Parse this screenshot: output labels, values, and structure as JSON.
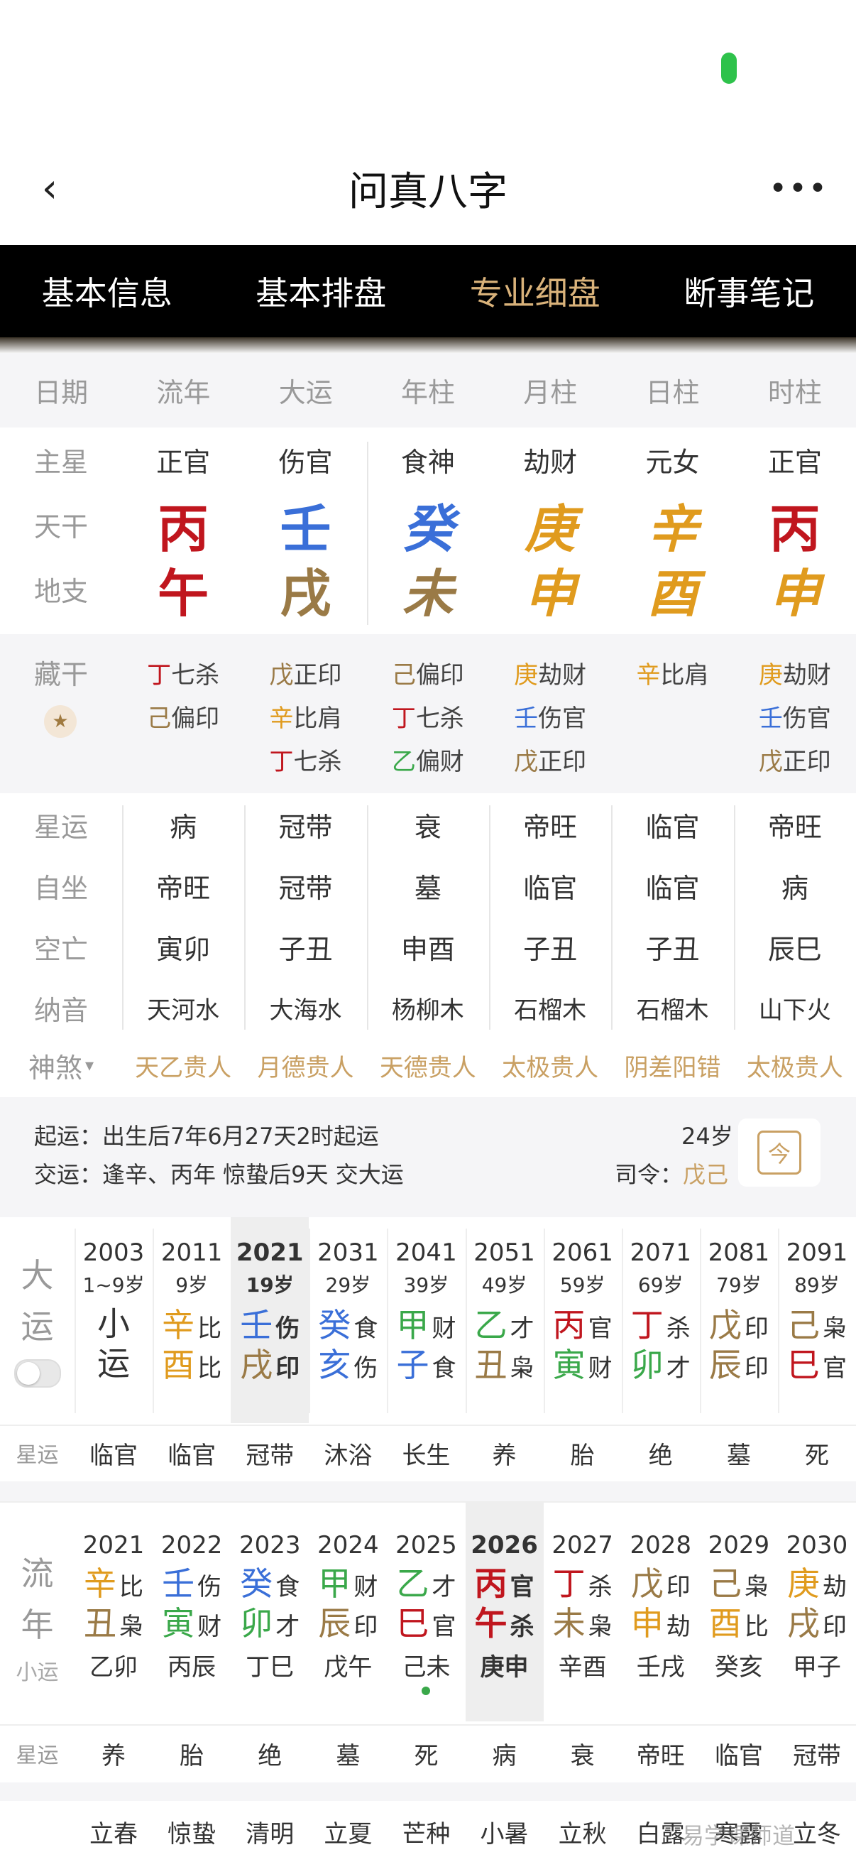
{
  "app": {
    "title": "问真八字",
    "back": "‹",
    "more": "•••"
  },
  "tabs": [
    {
      "label": "基本信息"
    },
    {
      "label": "基本排盘"
    },
    {
      "label": "专业细盘"
    },
    {
      "label": "断事笔记"
    }
  ],
  "pillar_header": [
    "日期",
    "流年",
    "大运",
    "年柱",
    "月柱",
    "日柱",
    "时柱"
  ],
  "main_star": {
    "label": "主星",
    "values": [
      "正官",
      "伤官",
      "食神",
      "劫财",
      "元女",
      "正官"
    ]
  },
  "tiangan": {
    "label": "天干",
    "values": [
      "丙",
      "壬",
      "癸",
      "庚",
      "辛",
      "丙"
    ],
    "colors": [
      "#c0161e",
      "#3a6fd8",
      "#3a6fd8",
      "#e09b1e",
      "#e09b1e",
      "#c0161e"
    ]
  },
  "dizhi": {
    "label": "地支",
    "values": [
      "午",
      "戌",
      "未",
      "申",
      "酉",
      "申"
    ],
    "colors": [
      "#c0161e",
      "#9a7a46",
      "#9a7a46",
      "#e09b1e",
      "#e09b1e",
      "#e09b1e"
    ]
  },
  "canggan": {
    "label": "藏干",
    "cols": [
      [
        {
          "g": "丁",
          "s": "七杀",
          "c": "#c0161e"
        },
        {
          "g": "己",
          "s": "偏印",
          "c": "#9a7a46"
        }
      ],
      [
        {
          "g": "戊",
          "s": "正印",
          "c": "#9a7a46"
        },
        {
          "g": "辛",
          "s": "比肩",
          "c": "#e09b1e"
        },
        {
          "g": "丁",
          "s": "七杀",
          "c": "#c0161e"
        }
      ],
      [
        {
          "g": "己",
          "s": "偏印",
          "c": "#9a7a46"
        },
        {
          "g": "丁",
          "s": "七杀",
          "c": "#c0161e"
        },
        {
          "g": "乙",
          "s": "偏财",
          "c": "#3aa84a"
        }
      ],
      [
        {
          "g": "庚",
          "s": "劫财",
          "c": "#e09b1e"
        },
        {
          "g": "壬",
          "s": "伤官",
          "c": "#3a6fd8"
        },
        {
          "g": "戊",
          "s": "正印",
          "c": "#9a7a46"
        }
      ],
      [
        {
          "g": "辛",
          "s": "比肩",
          "c": "#e09b1e"
        }
      ],
      [
        {
          "g": "庚",
          "s": "劫财",
          "c": "#e09b1e"
        },
        {
          "g": "壬",
          "s": "伤官",
          "c": "#3a6fd8"
        },
        {
          "g": "戊",
          "s": "正印",
          "c": "#9a7a46"
        }
      ]
    ]
  },
  "xingyun": {
    "label": "星运",
    "values": [
      "病",
      "冠带",
      "衰",
      "帝旺",
      "临官",
      "帝旺"
    ]
  },
  "zizuo": {
    "label": "自坐",
    "values": [
      "帝旺",
      "冠带",
      "墓",
      "临官",
      "临官",
      "病"
    ]
  },
  "kongwang": {
    "label": "空亡",
    "values": [
      "寅卯",
      "子丑",
      "申酉",
      "子丑",
      "子丑",
      "辰巳"
    ]
  },
  "nayin": {
    "label": "纳音",
    "values": [
      "天河水",
      "大海水",
      "杨柳木",
      "石榴木",
      "石榴木",
      "山下火"
    ]
  },
  "shensha": {
    "label": "神煞",
    "arrow": "▾",
    "values": [
      "天乙贵人",
      "月德贵人",
      "天德贵人",
      "太极贵人",
      "阴差阳错",
      "太极贵人"
    ]
  },
  "info": {
    "qiyun": "起运：出生后7年6月27天2时起运",
    "jiaoyun": "交运：逢辛、丙年 惊蛰后9天 交大运",
    "age": "24岁",
    "siling_label": "司令：",
    "siling_value": "戊己",
    "calendar_glyph": "今"
  },
  "dayun": {
    "label_chars": [
      "大",
      "运"
    ],
    "xiaoyun": {
      "year": "2003",
      "age": "1~9岁",
      "c1": "小",
      "c2": "运"
    },
    "cols": [
      {
        "year": "2011",
        "age": "9岁",
        "g1": "辛",
        "s1": "比",
        "c1": "#e09b1e",
        "g2": "酉",
        "s2": "比",
        "c2": "#e09b1e"
      },
      {
        "year": "2021",
        "age": "19岁",
        "g1": "壬",
        "s1": "伤",
        "c1": "#3a6fd8",
        "g2": "戌",
        "s2": "印",
        "c2": "#9a7a46",
        "active": true
      },
      {
        "year": "2031",
        "age": "29岁",
        "g1": "癸",
        "s1": "食",
        "c1": "#3a6fd8",
        "g2": "亥",
        "s2": "伤",
        "c2": "#3a6fd8"
      },
      {
        "year": "2041",
        "age": "39岁",
        "g1": "甲",
        "s1": "财",
        "c1": "#3aa84a",
        "g2": "子",
        "s2": "食",
        "c2": "#3a6fd8"
      },
      {
        "year": "2051",
        "age": "49岁",
        "g1": "乙",
        "s1": "才",
        "c1": "#3aa84a",
        "g2": "丑",
        "s2": "枭",
        "c2": "#9a7a46"
      },
      {
        "year": "2061",
        "age": "59岁",
        "g1": "丙",
        "s1": "官",
        "c1": "#c0161e",
        "g2": "寅",
        "s2": "财",
        "c2": "#3aa84a"
      },
      {
        "year": "2071",
        "age": "69岁",
        "g1": "丁",
        "s1": "杀",
        "c1": "#c0161e",
        "g2": "卯",
        "s2": "才",
        "c2": "#3aa84a"
      },
      {
        "year": "2081",
        "age": "79岁",
        "g1": "戊",
        "s1": "印",
        "c1": "#9a7a46",
        "g2": "辰",
        "s2": "印",
        "c2": "#9a7a46"
      },
      {
        "year": "2091",
        "age": "89岁",
        "g1": "己",
        "s1": "枭",
        "c1": "#9a7a46",
        "g2": "巳",
        "s2": "官",
        "c2": "#c0161e"
      }
    ],
    "xingyun_label": "星运",
    "xingyun": [
      "临官",
      "临官",
      "冠带",
      "沐浴",
      "长生",
      "养",
      "胎",
      "绝",
      "墓",
      "死"
    ]
  },
  "liunian": {
    "label_chars": [
      "流",
      "年"
    ],
    "sub_label": "小运",
    "cols": [
      {
        "year": "2021",
        "g1": "辛",
        "s1": "比",
        "c1": "#e09b1e",
        "g2": "丑",
        "s2": "枭",
        "c2": "#9a7a46",
        "xy": "乙卯"
      },
      {
        "year": "2022",
        "g1": "壬",
        "s1": "伤",
        "c1": "#3a6fd8",
        "g2": "寅",
        "s2": "财",
        "c2": "#3aa84a",
        "xy": "丙辰"
      },
      {
        "year": "2023",
        "g1": "癸",
        "s1": "食",
        "c1": "#3a6fd8",
        "g2": "卯",
        "s2": "才",
        "c2": "#3aa84a",
        "xy": "丁巳"
      },
      {
        "year": "2024",
        "g1": "甲",
        "s1": "财",
        "c1": "#3aa84a",
        "g2": "辰",
        "s2": "印",
        "c2": "#9a7a46",
        "xy": "戊午"
      },
      {
        "year": "2025",
        "g1": "乙",
        "s1": "才",
        "c1": "#3aa84a",
        "g2": "巳",
        "s2": "官",
        "c2": "#c0161e",
        "xy": "己未",
        "dot": true
      },
      {
        "year": "2026",
        "g1": "丙",
        "s1": "官",
        "c1": "#c0161e",
        "g2": "午",
        "s2": "杀",
        "c2": "#c0161e",
        "xy": "庚申",
        "active": true
      },
      {
        "year": "2027",
        "g1": "丁",
        "s1": "杀",
        "c1": "#c0161e",
        "g2": "未",
        "s2": "枭",
        "c2": "#9a7a46",
        "xy": "辛酉"
      },
      {
        "year": "2028",
        "g1": "戊",
        "s1": "印",
        "c1": "#9a7a46",
        "g2": "申",
        "s2": "劫",
        "c2": "#e09b1e",
        "xy": "壬戌"
      },
      {
        "year": "2029",
        "g1": "己",
        "s1": "枭",
        "c1": "#9a7a46",
        "g2": "酉",
        "s2": "比",
        "c2": "#e09b1e",
        "xy": "癸亥"
      },
      {
        "year": "2030",
        "g1": "庚",
        "s1": "劫",
        "c1": "#e09b1e",
        "g2": "戌",
        "s2": "印",
        "c2": "#9a7a46",
        "xy": "甲子"
      }
    ],
    "xingyun_label": "星运",
    "xingyun": [
      "养",
      "胎",
      "绝",
      "墓",
      "死",
      "病",
      "衰",
      "帝旺",
      "临官",
      "冠带"
    ]
  },
  "jieqi": [
    "立春",
    "惊蛰",
    "清明",
    "立夏",
    "芒种",
    "小暑",
    "立秋",
    "白露",
    "寒露",
    "立冬"
  ],
  "watermark": "易学课师道"
}
